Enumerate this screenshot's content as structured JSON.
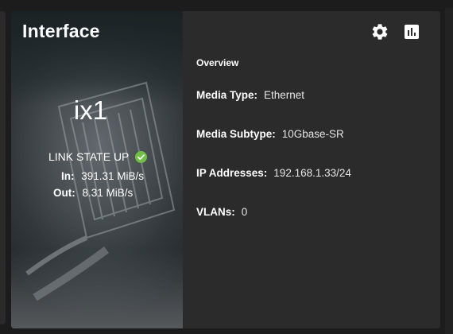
{
  "card": {
    "title": "Interface",
    "interface_name": "ix1",
    "link_state": "LINK STATE UP",
    "traffic": {
      "in_label": "In:",
      "in_value": "391.31 MiB/s",
      "out_label": "Out:",
      "out_value": "8.31 MiB/s"
    },
    "icons": {
      "settings": "gear-icon",
      "reports": "bar-chart-icon",
      "status": "check-circle-icon"
    },
    "overview": {
      "heading": "Overview",
      "media_type_label": "Media Type:",
      "media_type_value": "Ethernet",
      "media_subtype_label": "Media Subtype:",
      "media_subtype_value": "10Gbase-SR",
      "ip_label": "IP Addresses:",
      "ip_value": "192.168.1.33/24",
      "vlans_label": "VLANs:",
      "vlans_value": "0"
    }
  },
  "colors": {
    "card_bg": "#2b2b2b",
    "page_bg": "#1c1c1c",
    "status_ok": "#71bf44",
    "text": "#ffffff"
  }
}
